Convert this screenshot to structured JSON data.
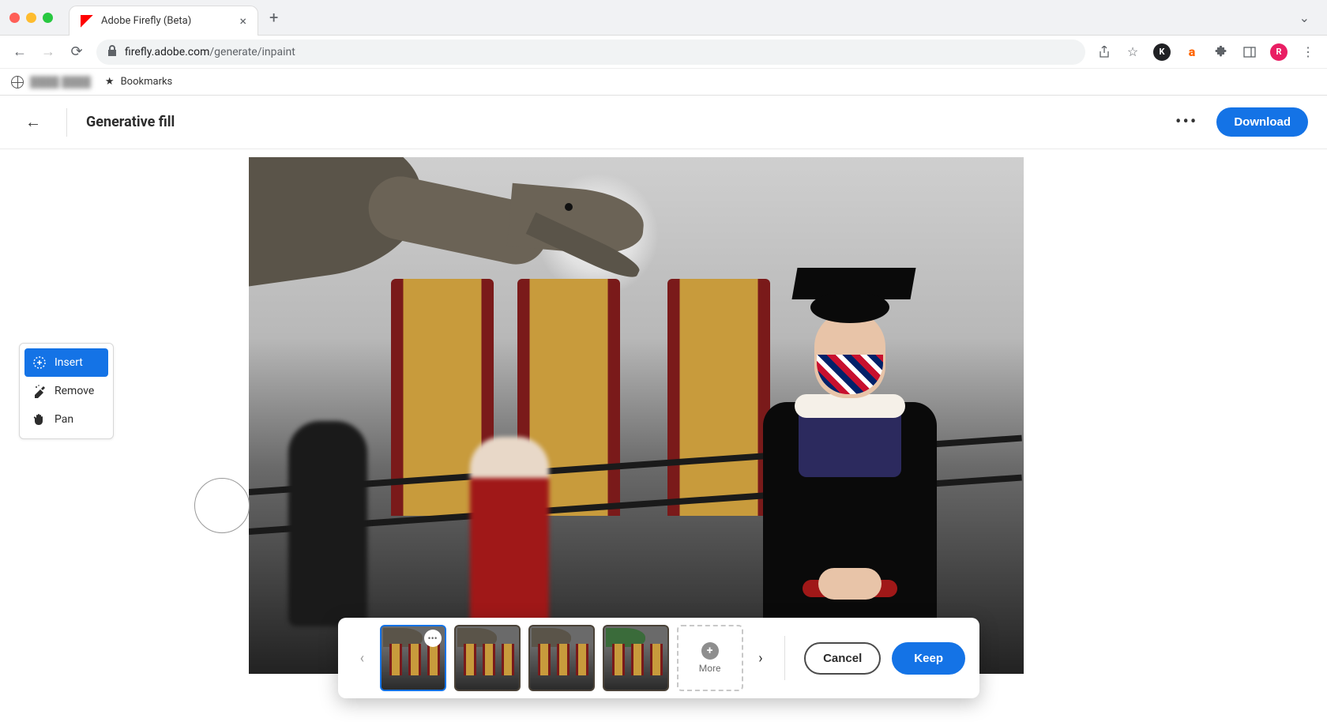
{
  "browser": {
    "tab_title": "Adobe Firefly (Beta)",
    "url_domain": "firefly.adobe.com",
    "url_path": "/generate/inpaint",
    "bookmarks_label": "Bookmarks"
  },
  "header": {
    "page_title": "Generative fill",
    "download_label": "Download"
  },
  "tools": {
    "insert_label": "Insert",
    "remove_label": "Remove",
    "pan_label": "Pan",
    "active": "insert"
  },
  "results": {
    "more_label": "More",
    "cancel_label": "Cancel",
    "keep_label": "Keep"
  }
}
